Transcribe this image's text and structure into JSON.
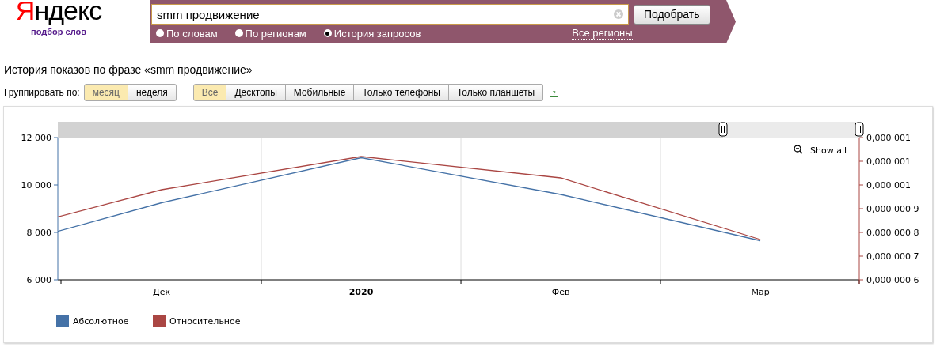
{
  "logo": {
    "text": "Яндекс",
    "link": "подбор слов"
  },
  "search": {
    "value": "smm продвижение",
    "button": "Подобрать",
    "region_link": "Все регионы",
    "modes": [
      {
        "label": "По словам",
        "selected": false
      },
      {
        "label": "По регионам",
        "selected": false
      },
      {
        "label": "История запросов",
        "selected": true
      }
    ]
  },
  "title": "История показов по фразе «smm продвижение»",
  "grouping": {
    "label": "Группировать по:",
    "options": [
      {
        "label": "месяц",
        "selected": true
      },
      {
        "label": "неделя",
        "selected": false
      }
    ]
  },
  "devices": [
    {
      "label": "Все",
      "selected": true
    },
    {
      "label": "Десктопы",
      "selected": false
    },
    {
      "label": "Мобильные",
      "selected": false
    },
    {
      "label": "Только телефоны",
      "selected": false
    },
    {
      "label": "Только планшеты",
      "selected": false
    }
  ],
  "help": "?",
  "chart": {
    "show_all": "Show all",
    "chart_data": {
      "type": "line",
      "categories": [
        null,
        "Дек",
        "2020",
        "Фев",
        "Мар"
      ],
      "legend": "bottom",
      "ylim": [
        6000,
        12000
      ],
      "yticks": [
        {
          "value": 6000,
          "label": "6 000"
        },
        {
          "value": 8000,
          "label": "8 000"
        },
        {
          "value": 10000,
          "label": "10 000"
        },
        {
          "value": 12000,
          "label": "12 000"
        }
      ],
      "y2ticks": [
        {
          "value": 1.2e-06,
          "label": "0,000 001"
        },
        {
          "value": 1.1e-06,
          "label": "0,000 001"
        },
        {
          "value": 1e-06,
          "label": "0,000 001"
        },
        {
          "value": 9e-07,
          "label": "0,000 000 9"
        },
        {
          "value": 8e-07,
          "label": "0,000 000 8"
        },
        {
          "value": 7e-07,
          "label": "0,000 000 7"
        },
        {
          "value": 6e-07,
          "label": "0,000 000 6"
        }
      ],
      "y2lim": [
        6e-07,
        1.2e-06
      ],
      "series": [
        {
          "name": "Абсолютное",
          "color": "#4572a7",
          "values": [
            6930,
            9250,
            11150,
            9600,
            7650
          ]
        },
        {
          "name": "Относительное",
          "color": "#aa4643",
          "axis": "y2",
          "values": [
            7.6e-07,
            9.8e-07,
            1.12e-06,
            1.03e-06,
            7.7e-07
          ]
        }
      ]
    }
  }
}
